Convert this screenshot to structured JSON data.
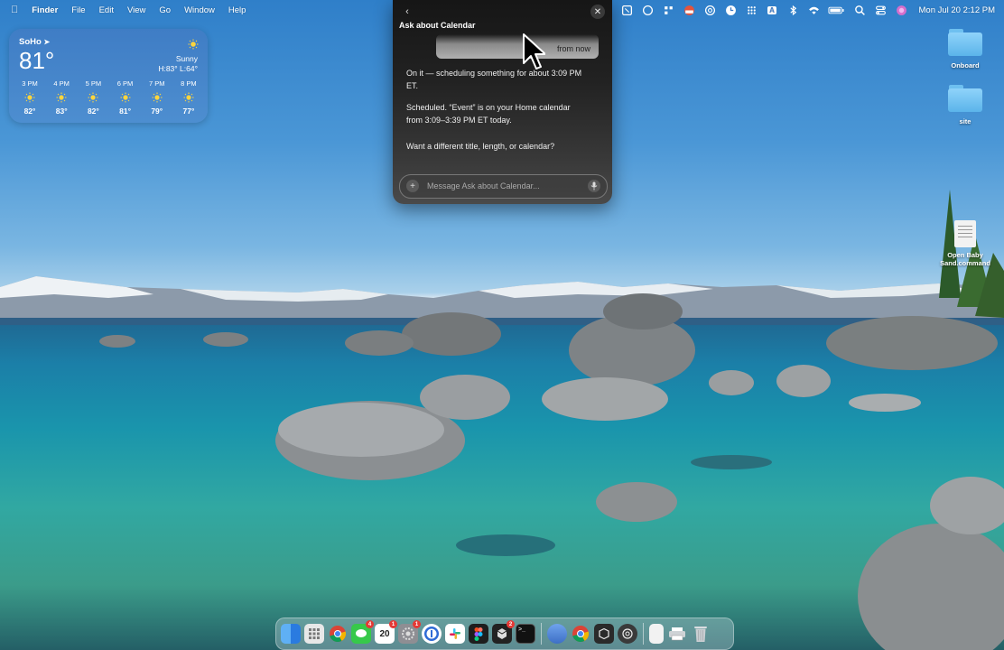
{
  "menubar": {
    "apple_icon": "apple-icon",
    "app_name": "Finder",
    "menus": [
      "File",
      "Edit",
      "View",
      "Go",
      "Window",
      "Help"
    ],
    "status_icons": [
      "screen-record-icon",
      "tool-icon",
      "circle-icon",
      "grid-icon",
      "flag-icon",
      "at-icon",
      "clock-icon",
      "dots-grid-icon",
      "text-input-icon",
      "bluetooth-icon",
      "wifi-icon",
      "battery-icon",
      "search-icon",
      "control-center-icon",
      "siri-icon"
    ],
    "input_source": "A",
    "clock": "Mon Jul 20  2:12 PM"
  },
  "weather": {
    "location": "SoHo",
    "temperature": "81°",
    "condition": "Sunny",
    "high_low": "H:83° L:64°",
    "hours": [
      {
        "time": "3 PM",
        "temp": "82°"
      },
      {
        "time": "4 PM",
        "temp": "83°"
      },
      {
        "time": "5 PM",
        "temp": "82°"
      },
      {
        "time": "6 PM",
        "temp": "81°"
      },
      {
        "time": "7 PM",
        "temp": "79°"
      },
      {
        "time": "8 PM",
        "temp": "77°"
      }
    ]
  },
  "desktop": {
    "items": [
      {
        "label": "Onboard",
        "kind": "folder"
      },
      {
        "label": "site",
        "kind": "folder"
      },
      {
        "label": "Open Baby Sand.command",
        "kind": "document"
      }
    ]
  },
  "chat": {
    "title": "Ask about Calendar",
    "bubble_text": "from now",
    "messages": [
      "On it — scheduling something for about 3:09 PM ET.",
      "Scheduled. “Event” is on your Home calendar from 3:09–3:39 PM ET today.",
      "Want a different title, length, or calendar?"
    ],
    "input_placeholder": "Message Ask about Calendar..."
  },
  "dock": {
    "apps": [
      {
        "name": "finder-icon",
        "color": "#3b8df0"
      },
      {
        "name": "launchpad-icon",
        "color": "#e8e8e8"
      },
      {
        "name": "chrome-icon",
        "color": "#ffffff"
      },
      {
        "name": "messages-icon",
        "color": "#37c94a",
        "badge": "4"
      },
      {
        "name": "calendar-icon",
        "color": "#ffffff",
        "label": "20",
        "badge": "1"
      },
      {
        "name": "settings-icon",
        "color": "#8e8e93",
        "badge": "1"
      },
      {
        "name": "1password-icon",
        "color": "#2f6bd6"
      },
      {
        "name": "slack-icon",
        "color": "#ffffff"
      },
      {
        "name": "figma-icon",
        "color": "#1e1e1e"
      },
      {
        "name": "cursor-app-icon",
        "color": "#222222",
        "badge": "2"
      },
      {
        "name": "terminal-icon",
        "color": "#111111"
      },
      {
        "name": "preview-icon",
        "color": "#4a7fd4"
      },
      {
        "name": "chrome-alt-icon",
        "color": "#ffffff"
      },
      {
        "name": "box-icon",
        "color": "#2a2a2a"
      },
      {
        "name": "openai-icon",
        "color": "#3a3a3a"
      },
      {
        "name": "document-icon",
        "color": "#f2f2f2"
      },
      {
        "name": "printer-icon",
        "color": "#e0e0e0"
      },
      {
        "name": "trash-icon",
        "color": "#c9ced2"
      }
    ]
  }
}
